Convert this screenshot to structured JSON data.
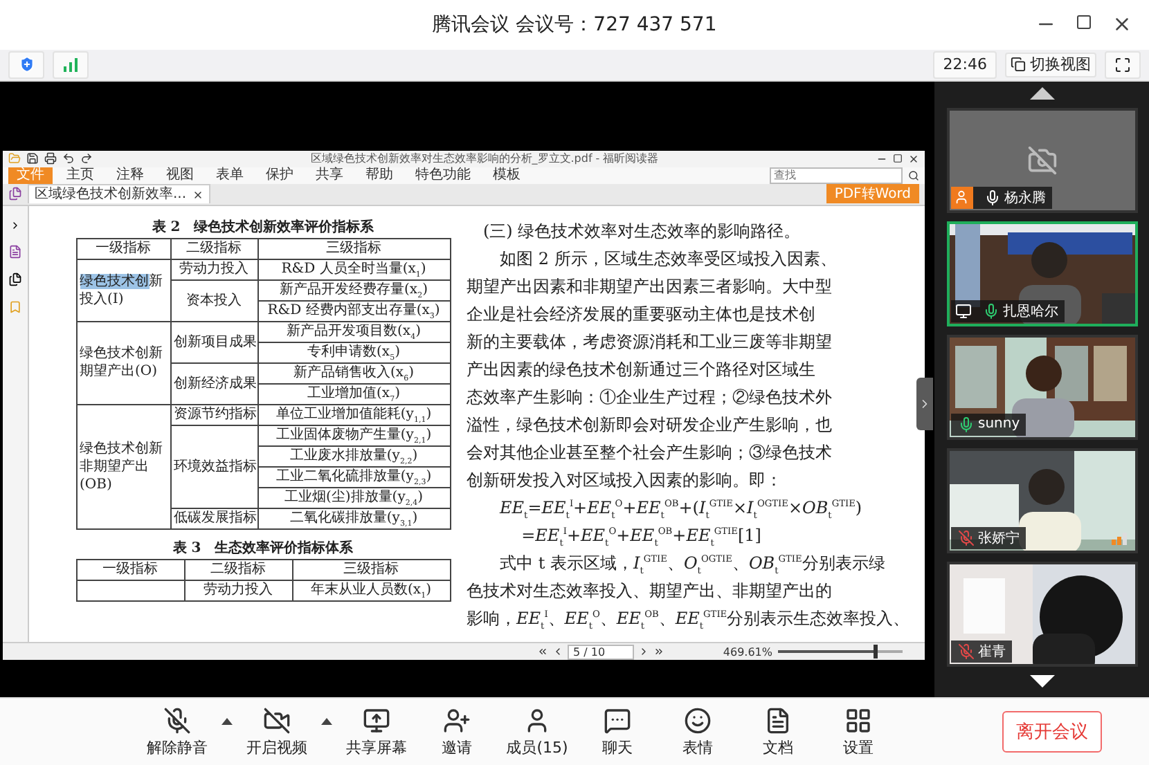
{
  "window": {
    "title": "腾讯会议 会议号：727 437 571"
  },
  "info_bar": {
    "time": "22:46",
    "switch_view": "切换视图"
  },
  "pdf_viewer": {
    "title": "区域绿色技术创新效率对生态效率影响的分析_罗立文.pdf - 福昕阅读器",
    "menu": [
      {
        "label": "文件",
        "selected": true
      },
      {
        "label": "主页",
        "selected": false
      },
      {
        "label": "注释",
        "selected": false
      },
      {
        "label": "视图",
        "selected": false
      },
      {
        "label": "表单",
        "selected": false
      },
      {
        "label": "保护",
        "selected": false
      },
      {
        "label": "共享",
        "selected": false
      },
      {
        "label": "帮助",
        "selected": false
      },
      {
        "label": "特色功能",
        "selected": false
      },
      {
        "label": "模板",
        "selected": false
      }
    ],
    "search": {
      "placeholder": "查找"
    },
    "doc_tab": "区域绿色技术创新效率...",
    "convert_button": "PDF转Word",
    "page": "5 / 10",
    "zoom": "469.61%",
    "zoom_slider": {
      "level": 0.8
    }
  },
  "document": {
    "table2": {
      "caption": "表 2　绿色技术创新效率评价指标系",
      "columns": [
        "一级指标",
        "二级指标",
        "三级指标"
      ],
      "groups": [
        {
          "level1_highlight": "绿色技术创",
          "level1": "新投入(I)",
          "subgroups": [
            {
              "level2": "劳动力投入",
              "items": [
                "R&D 人员全时当量(x$_{1}$)"
              ]
            },
            {
              "level2": "资本投入",
              "items": [
                "新产品开发经费存量(x$_{2}$)",
                "R&D 经费内部支出存量(x$_{3}$)"
              ]
            }
          ]
        },
        {
          "level1": "绿色技术创新期望产出(O)",
          "subgroups": [
            {
              "level2": "创新项目成果",
              "items": [
                "新产品开发项目数(x$_{4}$)",
                "专利申请数(x$_{5}$)"
              ]
            },
            {
              "level2": "创新经济成果",
              "items": [
                "新产品销售收入(x$_{6}$)",
                "工业增加值(x$_{7}$)"
              ]
            }
          ]
        },
        {
          "level1": "绿色技术创新非期望产出(OB)",
          "subgroups": [
            {
              "level2": "资源节约指标",
              "items": [
                "单位工业增加值能耗(y$_{1,1}$)"
              ]
            },
            {
              "level2": "环境效益指标",
              "items": [
                "工业固体废物产生量(y$_{2,1}$)",
                "工业废水排放量(y$_{2,2}$)",
                "工业二氧化硫排放量(y$_{2,3}$)",
                "工业烟(尘)排放量(y$_{2,4}$)"
              ]
            },
            {
              "level2": "低碳发展指标",
              "items": [
                "二氧化碳排放量(y$_{3,1}$)"
              ]
            }
          ]
        }
      ]
    },
    "table3": {
      "caption": "表 3　生态效率评价指标体系",
      "columns": [
        "一级指标",
        "二级指标",
        "三级指标"
      ],
      "rows": [
        {
          "level2": "劳动力投入",
          "level3": "年末从业人员数(x$_{1}$)"
        }
      ]
    },
    "heading": "(三) 绿色技术效率对生态效率的影响路径。",
    "paragraph1": [
      "如图 2 所示，区域生态效率受区域投入因素、",
      "期望产出因素和非期望产出因素三者影响。大中型",
      "企业是社会经济发展的重要驱动主体也是技术创",
      "新的主要载体，考虑资源消耗和工业三废等非期望",
      "产出因素的绿色技术创新通过三个路径对区域生",
      "态效率产生影响：①企业生产过程；②绿色技术外",
      "溢性，绿色技术创新即会对研发企业产生影响，也",
      "会对其他企业甚至整个社会产生影响；③绿色技术",
      "创新研发投入对区域投入因素的影响。即："
    ],
    "formula": [
      "*EE*$_{t}$=*EE*$_{t}$$^{I}$+*EE*$_{t}$$^{O}$+*EE*$_{t}$$^{OB}$+(*I*$_{t}$$^{GTIE}$×*I*$_{t}$$^{OGTIE}$×*OB*$_{t}$$^{GTIE}$)",
      "=*EE*$_{t}$$^{I}$+*EE*$_{t}$$^{O}$+*EE*$_{t}$$^{OB}$+*EE*$_{t}$$^{GTIE}$"
    ],
    "equation_number": "[1]",
    "paragraph2": [
      "式中 t 表示区域，*I*$_{t}$$^{GTIE}$、*O*$_{t}$$^{OGTIE}$、*OB*$_{t}$$^{GTIE}$分别表示绿",
      "色技术对生态效率投入、期望产出、非期望产出的",
      "影响，*EE*$_{t}$$^{I}$、*EE*$_{t}$$^{O}$、*EE*$_{t}$$^{OB}$、*EE*$_{t}$$^{GTIE}$分别表示生态效率投入、"
    ]
  },
  "participants": [
    {
      "name": "杨永腾",
      "video": false,
      "host": true,
      "muted": false,
      "mic_active": false,
      "speaking": false
    },
    {
      "name": "扎恩哈尔",
      "video": true,
      "sharing": true,
      "muted": false,
      "mic_active": true,
      "speaking": true
    },
    {
      "name": "sunny",
      "video": true,
      "muted": false,
      "mic_active": true,
      "speaking": false
    },
    {
      "name": "张娇宁",
      "video": true,
      "muted": true,
      "speaking": false,
      "weak_signal": true
    },
    {
      "name": "崔青",
      "video": true,
      "muted": true,
      "speaking": false
    }
  ],
  "toolbar": [
    {
      "label": "解除静音",
      "caret": true
    },
    {
      "label": "开启视频",
      "caret": true
    },
    {
      "label": "共享屏幕",
      "caret": false
    },
    {
      "label": "邀请",
      "caret": false
    },
    {
      "label": "成员(15)",
      "caret": false
    },
    {
      "label": "聊天",
      "caret": false
    },
    {
      "label": "表情",
      "caret": false
    },
    {
      "label": "文档",
      "caret": false
    },
    {
      "label": "设置",
      "caret": false
    }
  ],
  "leave_button": "离开会议"
}
